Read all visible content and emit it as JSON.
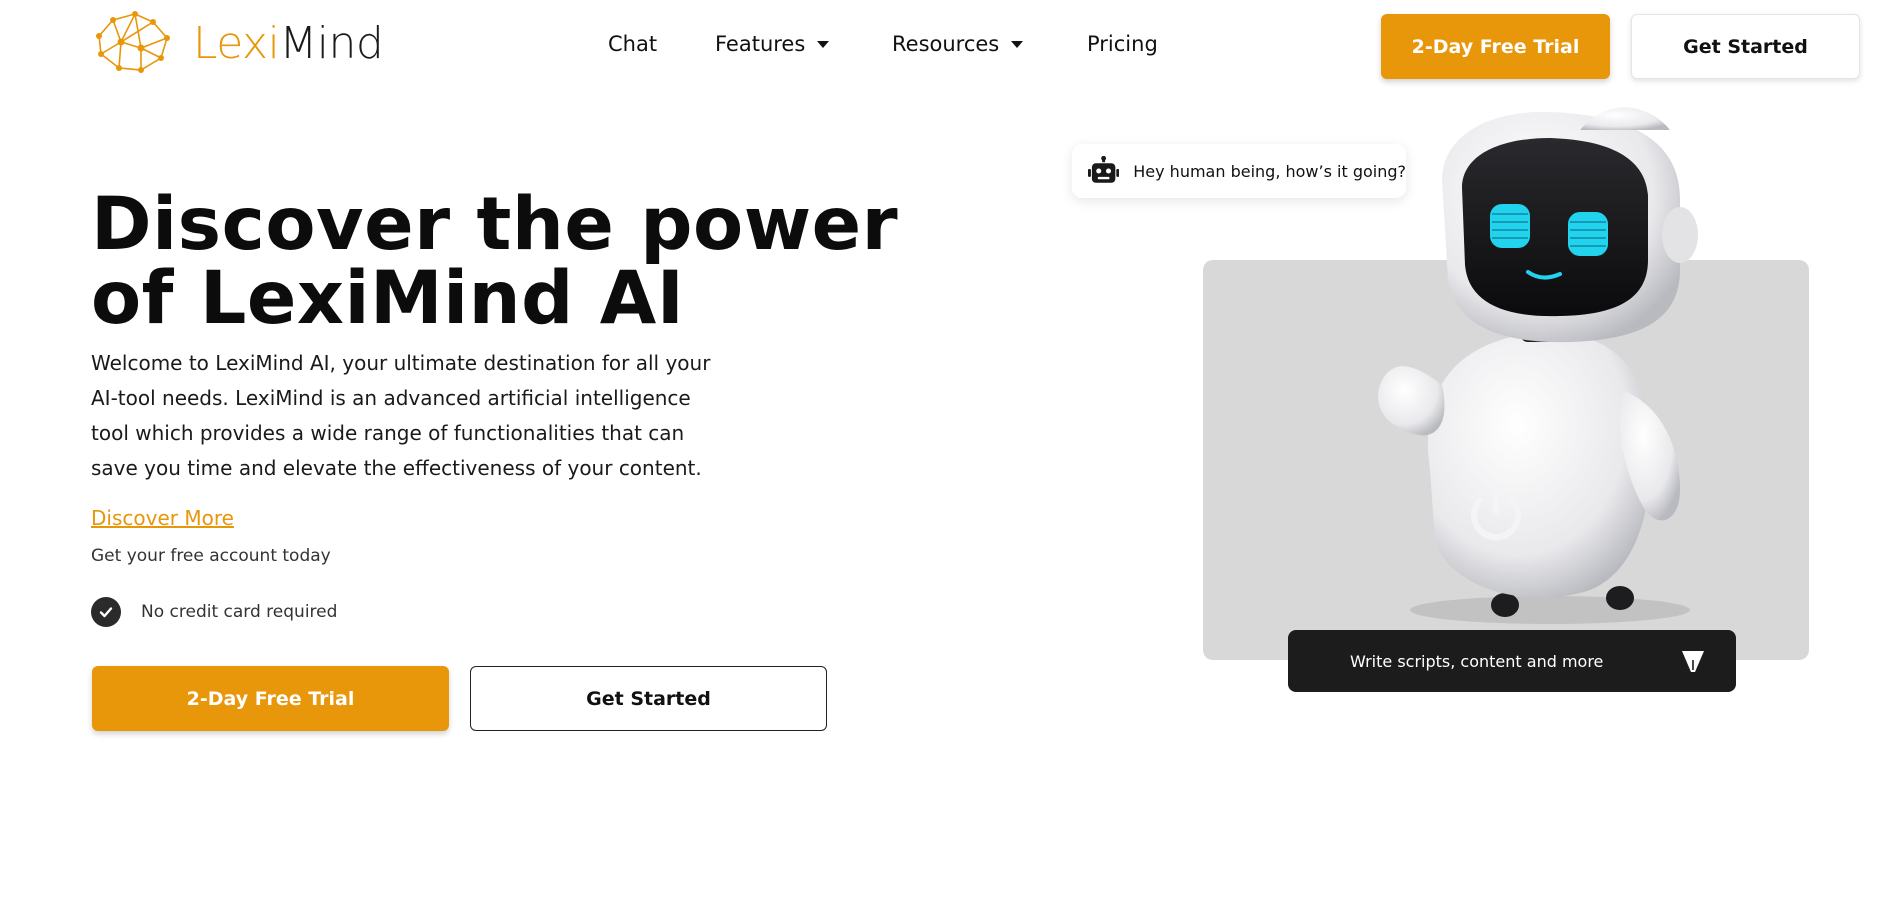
{
  "logo": {
    "part_a": "Lexi",
    "part_b": "Mind",
    "icon": "network-brain-icon"
  },
  "nav": {
    "items": [
      {
        "label": "Chat",
        "has_dropdown": false
      },
      {
        "label": "Features",
        "has_dropdown": true
      },
      {
        "label": "Resources",
        "has_dropdown": true
      },
      {
        "label": "Pricing",
        "has_dropdown": false
      }
    ],
    "trial_button": "2-Day Free Trial",
    "get_started_button": "Get Started"
  },
  "hero": {
    "title_line1": "Discover the power",
    "title_line2": "of LexiMind AI",
    "description": "Welcome to LexiMind AI, your ultimate destination for all your AI-tool needs. LexiMind is an advanced artificial intelligence tool which provides a wide range of functionalities that can save you time and elevate the effectiveness of your content.",
    "discover_link": "Discover More",
    "free_account_text": "Get your free account today",
    "no_credit_card": "No credit card required",
    "trial_button": "2-Day Free Trial",
    "get_started_button": "Get Started"
  },
  "visual": {
    "chat_bubble_text": "Hey human being, how’s it going?",
    "chat_bubble_icon": "robot-icon",
    "caption_text": "Write scripts, content and more",
    "caption_icon": "pen-nib-icon"
  },
  "colors": {
    "accent": "#e8960a",
    "dark": "#1c1c1c",
    "panel": "#d8d8d8",
    "robot_eyes": "#22d3ee"
  }
}
